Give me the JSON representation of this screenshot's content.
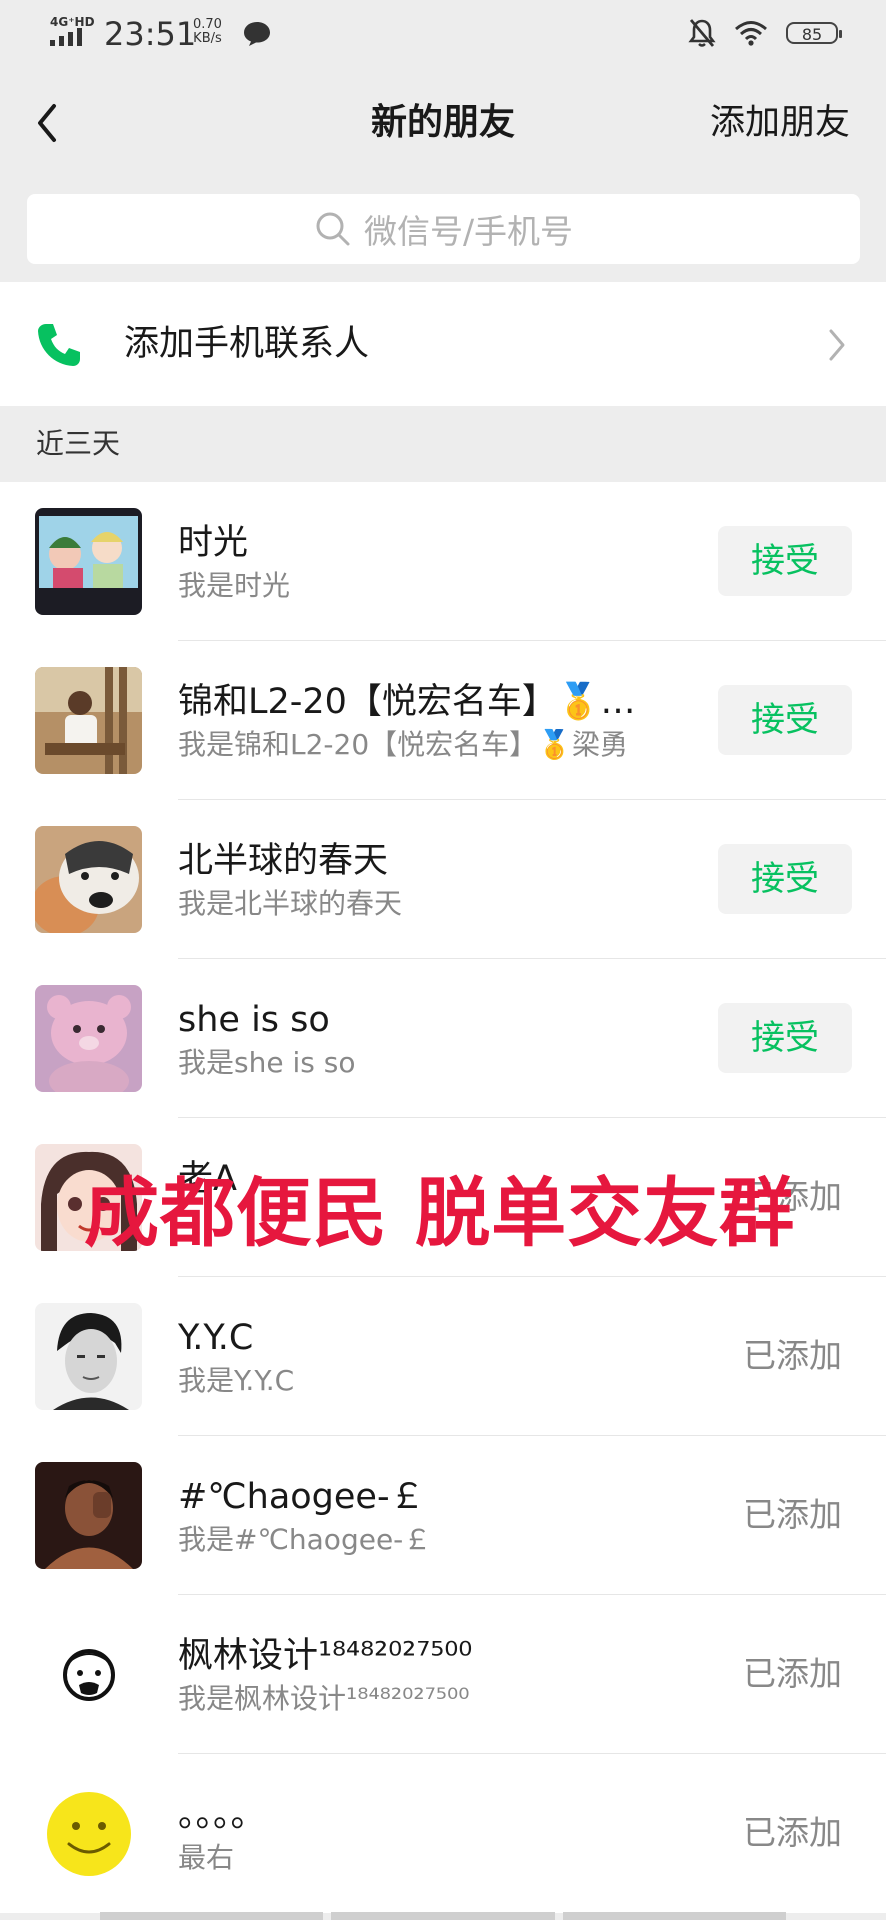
{
  "status": {
    "network": "4G⁺HD",
    "time": "23:51",
    "speed_value": "0.70",
    "speed_unit": "KB/s",
    "battery": "85"
  },
  "nav": {
    "title": "新的朋友",
    "action": "添加朋友"
  },
  "search": {
    "placeholder": "微信号/手机号"
  },
  "phone_contacts": {
    "label": "添加手机联系人"
  },
  "section": {
    "title": "近三天"
  },
  "requests": [
    {
      "name": "时光",
      "sub": "我是时光",
      "status": "接受",
      "type": "accept"
    },
    {
      "name": "锦和L2-20【悦宏名车】🥇…",
      "sub": "我是锦和L2-20【悦宏名车】🥇梁勇",
      "status": "接受",
      "type": "accept"
    },
    {
      "name": "北半球的春天",
      "sub": "我是北半球的春天",
      "status": "接受",
      "type": "accept"
    },
    {
      "name": "she  is  so",
      "sub": "我是she  is  so",
      "status": "接受",
      "type": "accept"
    },
    {
      "name": "老A",
      "sub": "",
      "status": "已添加",
      "type": "added"
    },
    {
      "name": "Y.Y.C",
      "sub": "我是Y.Y.C",
      "status": "已添加",
      "type": "added"
    },
    {
      "name": "#℃haogee-￡",
      "sub": "我是#℃haogee-￡",
      "status": "已添加",
      "type": "added"
    },
    {
      "name": "枫林设计¹⁸⁴⁸²⁰²⁷⁵⁰⁰",
      "sub": "我是枫林设计¹⁸⁴⁸²⁰²⁷⁵⁰⁰",
      "status": "已添加",
      "type": "added"
    },
    {
      "name": "。。。。",
      "sub": "最右",
      "status": "已添加",
      "type": "added"
    }
  ],
  "overlay_text": "成都便民 脱单交友群",
  "colors": {
    "accent": "#07c160",
    "overlay": "#e6173e",
    "background": "#ededed"
  }
}
